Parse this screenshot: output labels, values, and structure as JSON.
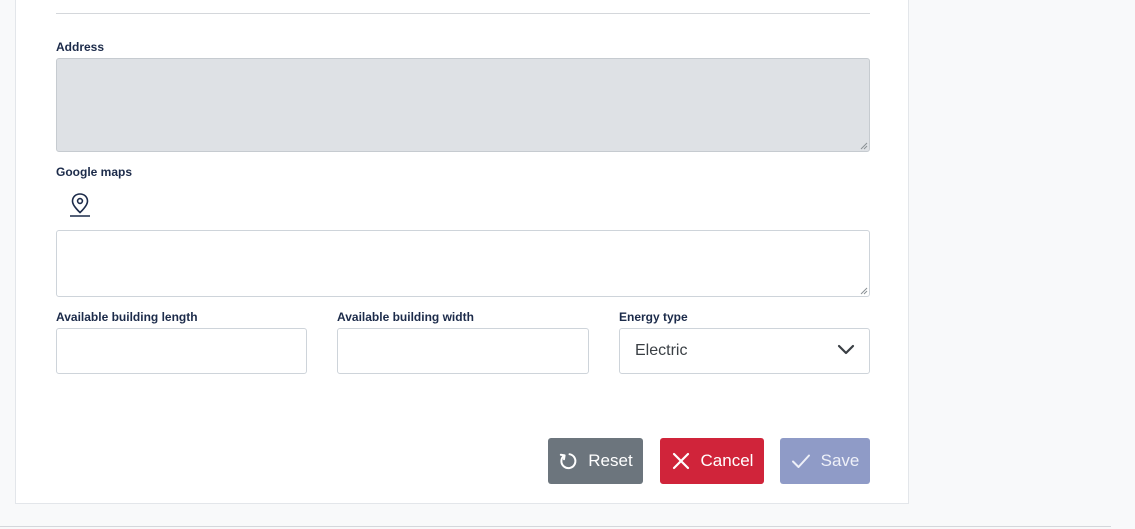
{
  "form": {
    "address_label": "Address",
    "google_maps_label": "Google maps",
    "length_label": "Available building length",
    "width_label": "Available building width",
    "energy_label": "Energy type",
    "energy_value": "Electric"
  },
  "actions": {
    "reset_label": "Reset",
    "cancel_label": "Cancel",
    "save_label": "Save"
  },
  "icons": {
    "map": "map-pin-icon",
    "select": "chevron-down-icon",
    "reset": "rotate-cw-icon",
    "cancel": "x-icon",
    "save": "check-icon"
  },
  "colors": {
    "reset": "#6c757d",
    "cancel": "#d0243a",
    "save": "#8f9bc7",
    "label": "#1c2b4a"
  }
}
